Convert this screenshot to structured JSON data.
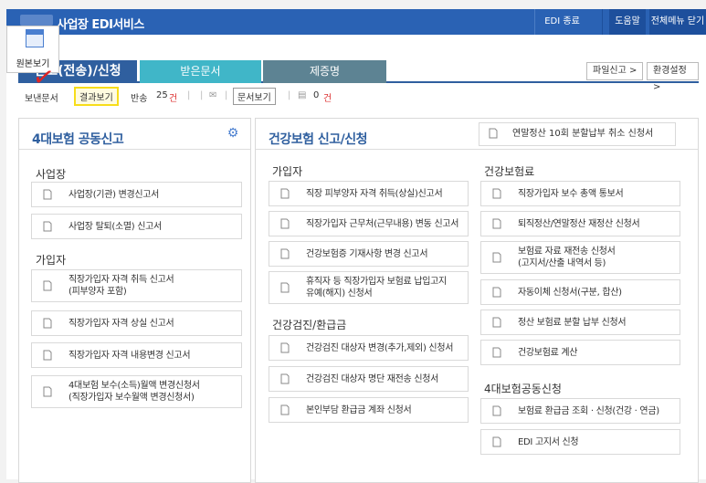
{
  "topbar": {
    "title": "사업장 EDI서비스",
    "edi_end": "EDI 종료",
    "help": "도움말",
    "all_menu": "전체메뉴 닫기"
  },
  "orig_view": {
    "label": "원본보기"
  },
  "tabs": [
    {
      "label": "신고(전송)/신청"
    },
    {
      "label": "받은문서"
    },
    {
      "label": "제증명"
    }
  ],
  "right_buttons": {
    "file_report": "파일신고 >",
    "env_settings": "환경설정 >"
  },
  "subbar": {
    "sent_label": "보낸문서",
    "result_view": "결과보기",
    "returned_label": "반송",
    "returned_count": "25",
    "returned_unit": "건",
    "doc_view": "문서보기",
    "zero_count": "0",
    "zero_unit": "건"
  },
  "left_panel": {
    "title": "4대보험 공동신고",
    "sections": [
      {
        "label": "사업장",
        "items": [
          "사업장(기관) 변경신고서",
          "사업장 탈퇴(소멸) 신고서"
        ]
      },
      {
        "label": "가입자",
        "items": [
          "직장가입자 자격 취득 신고서\n(피부양자 포함)",
          "직장가입자 자격 상실 신고서",
          "직장가입자 자격 내용변경 신고서",
          "4대보험 보수(소득)월액 변경신청서\n(직장가입자 보수월액 변경신청서)"
        ]
      }
    ]
  },
  "right_panel": {
    "title": "건강보험 신고/신청",
    "head_link": "연말정산 10회 분할납부 취소 신청서",
    "col1": [
      {
        "label": "가입자",
        "items": [
          "직장 피부양자 자격 취득(상실)신고서",
          "직장가입자 근무처(근무내용) 변동 신고서",
          "건강보험증 기재사항 변경 신고서",
          "휴직자 등 직장가입자 보험료 납입고지\n유예(해지) 신청서"
        ]
      },
      {
        "label": "건강검진/환급금",
        "items": [
          "건강검진 대상자 변경(추가,제외) 신청서",
          "건강검진 대상자 명단 재전송 신청서",
          "본인부담 환급금 계좌 신청서"
        ]
      }
    ],
    "col2": [
      {
        "label": "건강보험료",
        "items": [
          "직장가입자 보수 총액 통보서",
          "퇴직정산/연말정산 재정산 신청서",
          "보험료 자료 재전송 신청서\n(고지서/산출 내역서 등)",
          "자동이체 신청서(구분, 합산)",
          "정산 보험료 분할 납부 신청서",
          "건강보험료 계산"
        ]
      },
      {
        "label": "4대보험공동신청",
        "items": [
          "보험료 환급금 조회 · 신청(건강 · 연금)",
          "EDI 고지서 신청"
        ]
      }
    ]
  },
  "colors": {
    "primary": "#2f5f9f",
    "topbar": "#2a62b4",
    "recv_tab": "#40b6c8",
    "cert_tab": "#5d8393",
    "highlight": "#f7dd1a"
  }
}
